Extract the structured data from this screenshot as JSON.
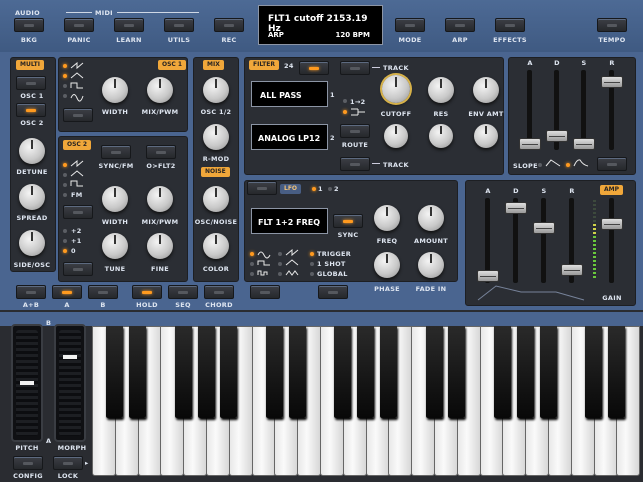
{
  "top": {
    "audio_label": "AUDIO",
    "midi_label": "MIDI",
    "buttons": {
      "bkg": "BKG",
      "panic": "PANIC",
      "learn": "LEARN",
      "utils": "UTILS",
      "rec": "REC",
      "mode": "MODE",
      "arp": "ARP",
      "effects": "EFFECTS",
      "tempo": "TEMPO"
    },
    "display": {
      "line1": "FLT1 cutoff 2153.19 Hz",
      "arp": "ARP",
      "bpm": "120 BPM"
    }
  },
  "osc1": {
    "multi_label": "MULTI",
    "title": "OSC 1",
    "osc1_btn": "OSC 1",
    "osc2_btn": "OSC 2",
    "width": "WIDTH",
    "mixpwm": "MIX/PWM",
    "detune": "DETUNE",
    "spread": "SPREAD",
    "sideosc": "SIDE/OSC"
  },
  "osc2": {
    "title": "OSC 2",
    "syncfm": "SYNC/FM",
    "oflt2": "O>FLT2",
    "fm": "FM",
    "width": "WIDTH",
    "mixpwm": "MIX/PWM",
    "oct_plus2": "+2",
    "oct_plus1": "+1",
    "oct_zero": "0",
    "tune": "TUNE",
    "fine": "FINE"
  },
  "mix": {
    "title": "MIX",
    "osc12": "OSC 1/2",
    "rmod": "R-MOD",
    "noise_title": "NOISE",
    "oscnoise": "OSC/NOISE",
    "color": "COLOR"
  },
  "filter": {
    "title": "FILTER",
    "range": "24",
    "track": "TRACK",
    "type1": "ALL PASS",
    "type2": "ANALOG LP12",
    "n1": "1",
    "n2": "2",
    "route_12": "1→2",
    "route": "ROUTE",
    "cutoff": "CUTOFF",
    "res": "RES",
    "envamt": "ENV AMT",
    "track2": "TRACK"
  },
  "fenv": {
    "a": "A",
    "d": "D",
    "s": "S",
    "r": "R",
    "slope": "SLOPE"
  },
  "lfo": {
    "title": "LFO",
    "n1": "1",
    "n2": "2",
    "dest": "FLT 1+2 FREQ",
    "sync": "SYNC",
    "freq": "FREQ",
    "amount": "AMOUNT",
    "trigger": "TRIGGER",
    "oneshot": "1 SHOT",
    "global": "GLOBAL",
    "phase": "PHASE",
    "fadein": "FADE IN"
  },
  "amp": {
    "a": "A",
    "d": "D",
    "s": "S",
    "r": "R",
    "title": "AMP",
    "gain": "GAIN"
  },
  "bottom": {
    "ab": "A+B",
    "a": "A",
    "b": "B",
    "hold": "HOLD",
    "seq": "SEQ",
    "chord": "CHORD"
  },
  "wheels": {
    "pitch": "PITCH",
    "morph": "MORPH",
    "b_mark": "B",
    "a_mark": "A",
    "config": "CONFIG",
    "lock": "LOCK"
  },
  "colors": {
    "panel": "#4a6590",
    "accent": "#ff9a1f"
  }
}
